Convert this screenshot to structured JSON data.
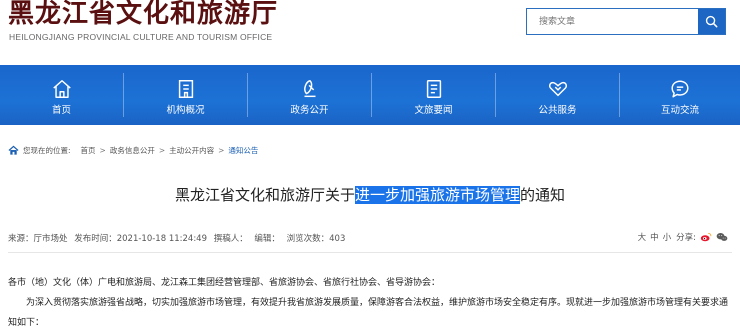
{
  "header": {
    "title": "黑龙江省文化和旅游厅",
    "subtitle": "HEILONGJIANG PROVINCIAL CULTURE AND TOURISM OFFICE",
    "search_placeholder": "搜索文章"
  },
  "nav": [
    {
      "label": "首页",
      "icon": "home-icon"
    },
    {
      "label": "机构概况",
      "icon": "building-icon"
    },
    {
      "label": "政务公开",
      "icon": "megaphone-icon"
    },
    {
      "label": "文旅要闻",
      "icon": "document-icon"
    },
    {
      "label": "公共服务",
      "icon": "handshake-icon"
    },
    {
      "label": "互动交流",
      "icon": "chat-icon"
    }
  ],
  "breadcrumb": {
    "prefix": "您现在的位置:",
    "items": [
      "首页",
      "政务信息公开",
      "主动公开内容",
      "通知公告"
    ],
    "separator": ">"
  },
  "article": {
    "title_before": "黑龙江省文化和旅游厅关于",
    "title_highlight": "进一步加强旅游市场管理",
    "title_after": "的通知",
    "meta": {
      "source": "来源：厅市场处",
      "published": "发布时间：2021-10-18 11:24:49",
      "author": "撰稿人：",
      "editor": "编辑：",
      "views": "浏览次数：403"
    },
    "font_sizes": [
      "大",
      "中",
      "小"
    ],
    "share_label": "分享:",
    "salutation": "各市（地）文化（体）广电和旅游局、龙江森工集团经营管理部、省旅游协会、省旅行社协会、省导游协会：",
    "paragraph": "为深入贯彻落实旅游强省战略，切实加强旅游市场管理，有效提升我省旅游发展质量，保障游客合法权益，维护旅游市场安全稳定有序。现就进一步加强旅游市场管理有关要求通知如下："
  },
  "colors": {
    "nav_blue": "#1d6fd4",
    "title_red": "#5a1010",
    "highlight": "#1a73e8"
  }
}
